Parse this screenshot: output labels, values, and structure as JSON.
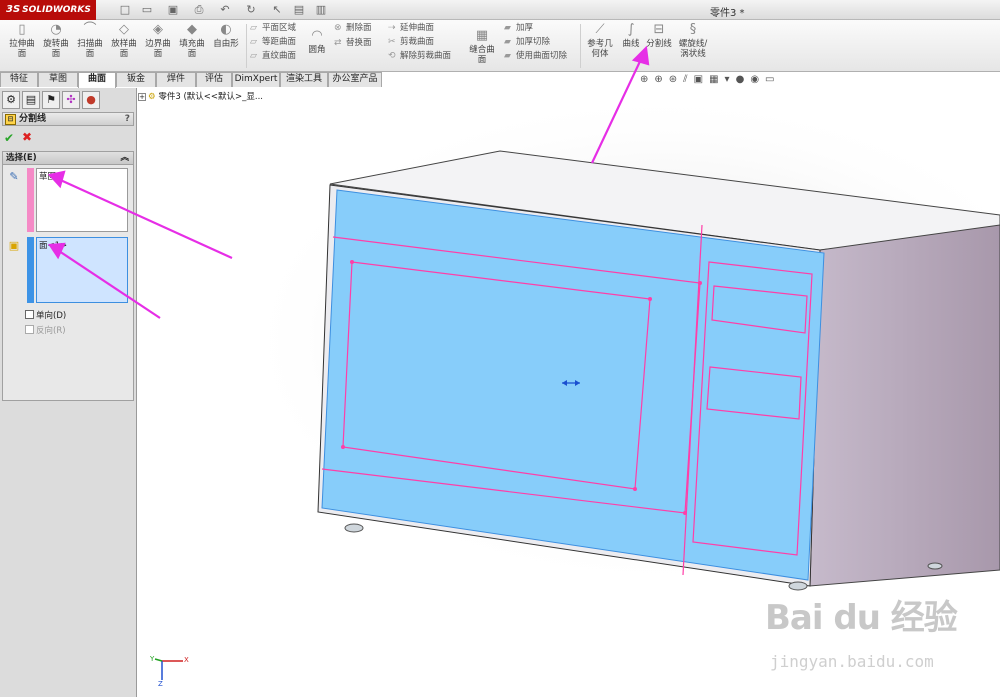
{
  "app": {
    "brand": "SOLIDWORKS",
    "brand_prefix": "3S",
    "document_title": "零件3 *"
  },
  "ribbon": {
    "big_buttons": [
      {
        "label1": "拉伸曲",
        "label2": "面"
      },
      {
        "label1": "旋转曲",
        "label2": "面"
      },
      {
        "label1": "扫描曲",
        "label2": "面"
      },
      {
        "label1": "放样曲",
        "label2": "面"
      },
      {
        "label1": "边界曲",
        "label2": "面"
      },
      {
        "label1": "填充曲",
        "label2": "面"
      },
      {
        "label1": "自由形",
        "label2": ""
      }
    ],
    "col1": [
      "平面区域",
      "等距曲面",
      "直纹曲面"
    ],
    "fillet": "圆角",
    "col2": [
      "删除面",
      "替换面"
    ],
    "col3": [
      "延伸曲面",
      "剪裁曲面",
      "解除剪裁曲面"
    ],
    "knit": {
      "label1": "缝合曲",
      "label2": "面"
    },
    "col4": [
      "加厚",
      "加厚切除",
      "使用曲面切除"
    ],
    "ref_geom": {
      "label1": "参考几",
      "label2": "何体"
    },
    "curves": "曲线",
    "split_line": "分割线",
    "helix": {
      "label1": "螺旋线/",
      "label2": "涡状线"
    }
  },
  "tabs": [
    "特征",
    "草图",
    "曲面",
    "钣金",
    "焊件",
    "评估",
    "DimXpert",
    "渲染工具",
    "办公室产品"
  ],
  "active_tab": "曲面",
  "property_manager": {
    "title": "分割线",
    "help": "?",
    "ok_symbol": "✔",
    "cancel_symbol": "✖",
    "section_title": "选择(E)",
    "sketch_item": "草图4",
    "face_item": "面<1>",
    "checkbox_single": "单向(D)",
    "checkbox_reverse": "反向(R)"
  },
  "tree": {
    "breadcrumb": "零件3 (默认<<默认>_显..."
  },
  "watermark": {
    "main": "Bai du 经验",
    "sub": "jingyan.baidu.com"
  },
  "colors": {
    "accent_face": "#87cdfa",
    "sketch": "#ff3ea8",
    "arrow": "#e62ee6",
    "brand_red": "#b80c09"
  }
}
